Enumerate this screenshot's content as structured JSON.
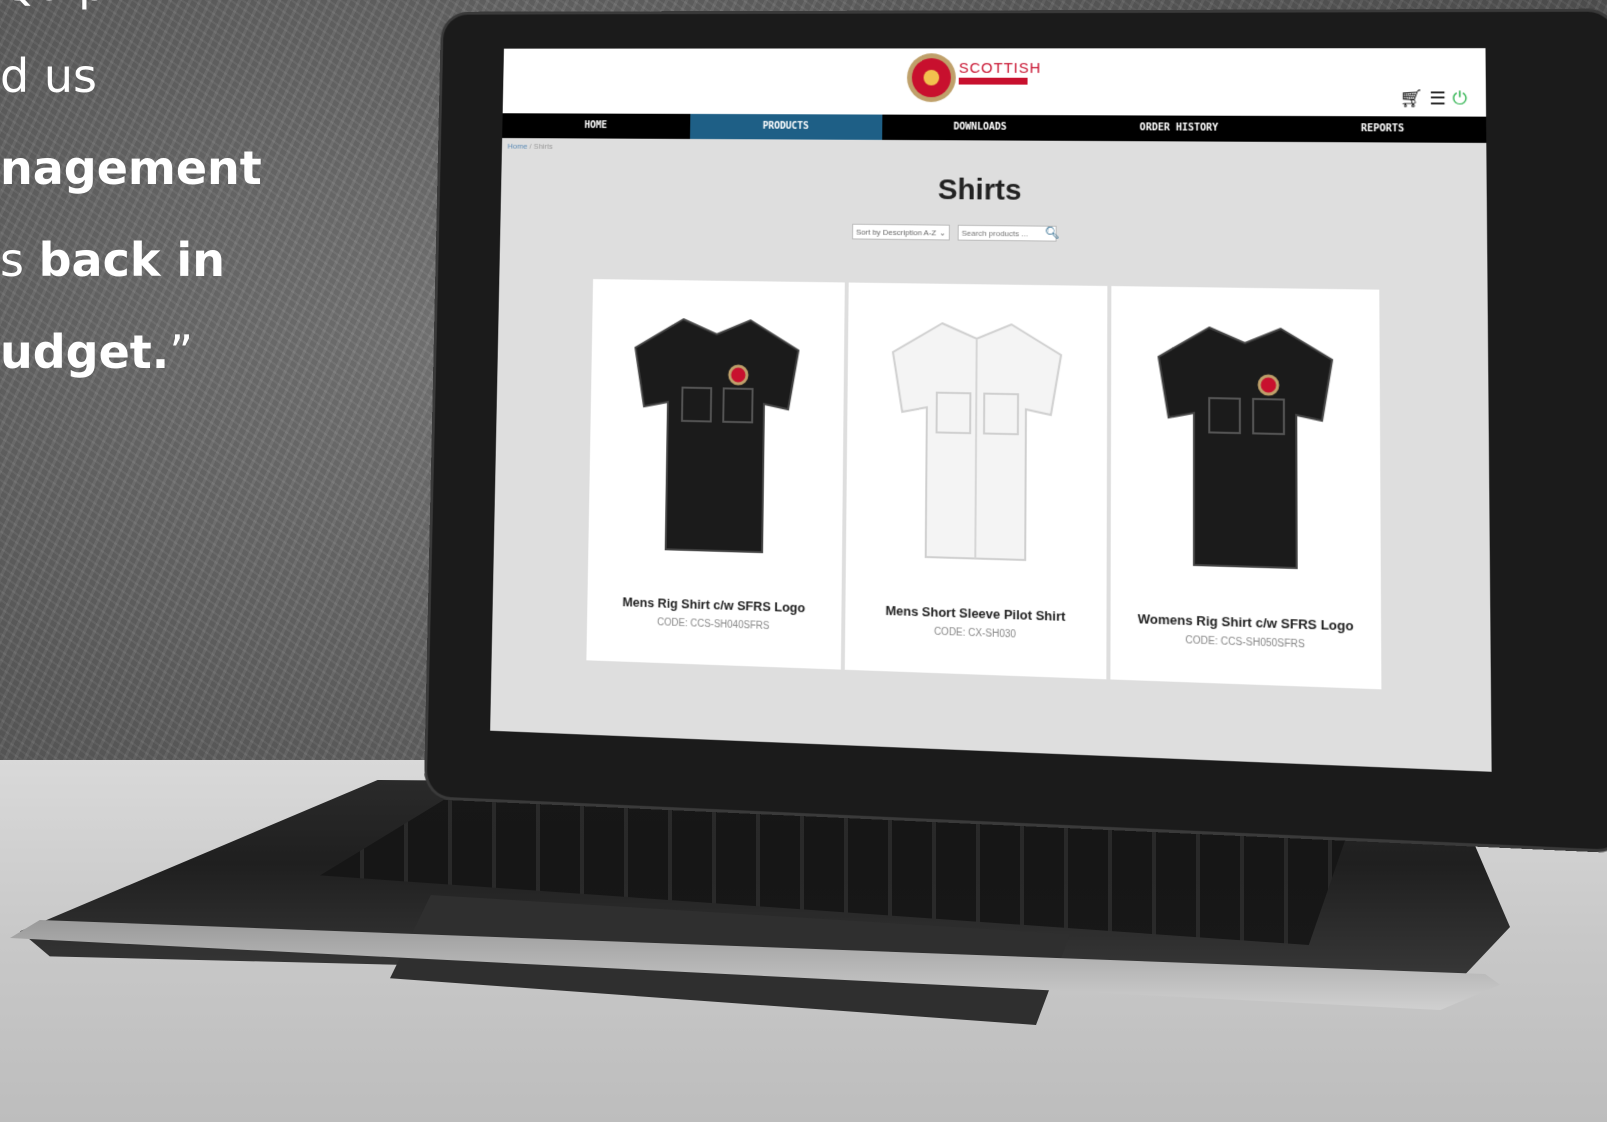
{
  "quote": {
    "line1": "Quip",
    "line2": "d us",
    "line3": "nagement",
    "line4_prefix": "s ",
    "line4_bold": "back in",
    "line5": "udget.",
    "line5_mark": "”"
  },
  "site": {
    "logo_text": "SCOTTISH",
    "nav": [
      {
        "label": "HOME"
      },
      {
        "label": "PRODUCTS",
        "active": true
      },
      {
        "label": "DOWNLOADS"
      },
      {
        "label": "ORDER HISTORY"
      },
      {
        "label": "REPORTS"
      }
    ],
    "breadcrumb": {
      "home": "Home",
      "sep": "/",
      "current": "Shirts"
    },
    "page_title": "Shirts",
    "sort": {
      "selected": "Sort by Description A-Z"
    },
    "search": {
      "placeholder": "Search products ..."
    },
    "accent_color": "#1e5f86",
    "brand_color": "#c8102e",
    "icons": [
      "basket-icon",
      "menu-icon",
      "power-icon",
      "search-icon",
      "arrow-up-icon"
    ],
    "products": [
      {
        "name": "Mens Rig Shirt c/w SFRS Logo",
        "code": "CODE: CCS-SH040SFRS",
        "shirt_color": "#1b1b1b"
      },
      {
        "name": "Mens Short Sleeve Pilot Shirt",
        "code": "CODE: CX-SH030",
        "shirt_color": "#f4f4f4"
      },
      {
        "name": "Womens Rig Shirt c/w SFRS Logo",
        "code": "CODE: CCS-SH050SFRS",
        "shirt_color": "#1b1b1b"
      }
    ]
  }
}
